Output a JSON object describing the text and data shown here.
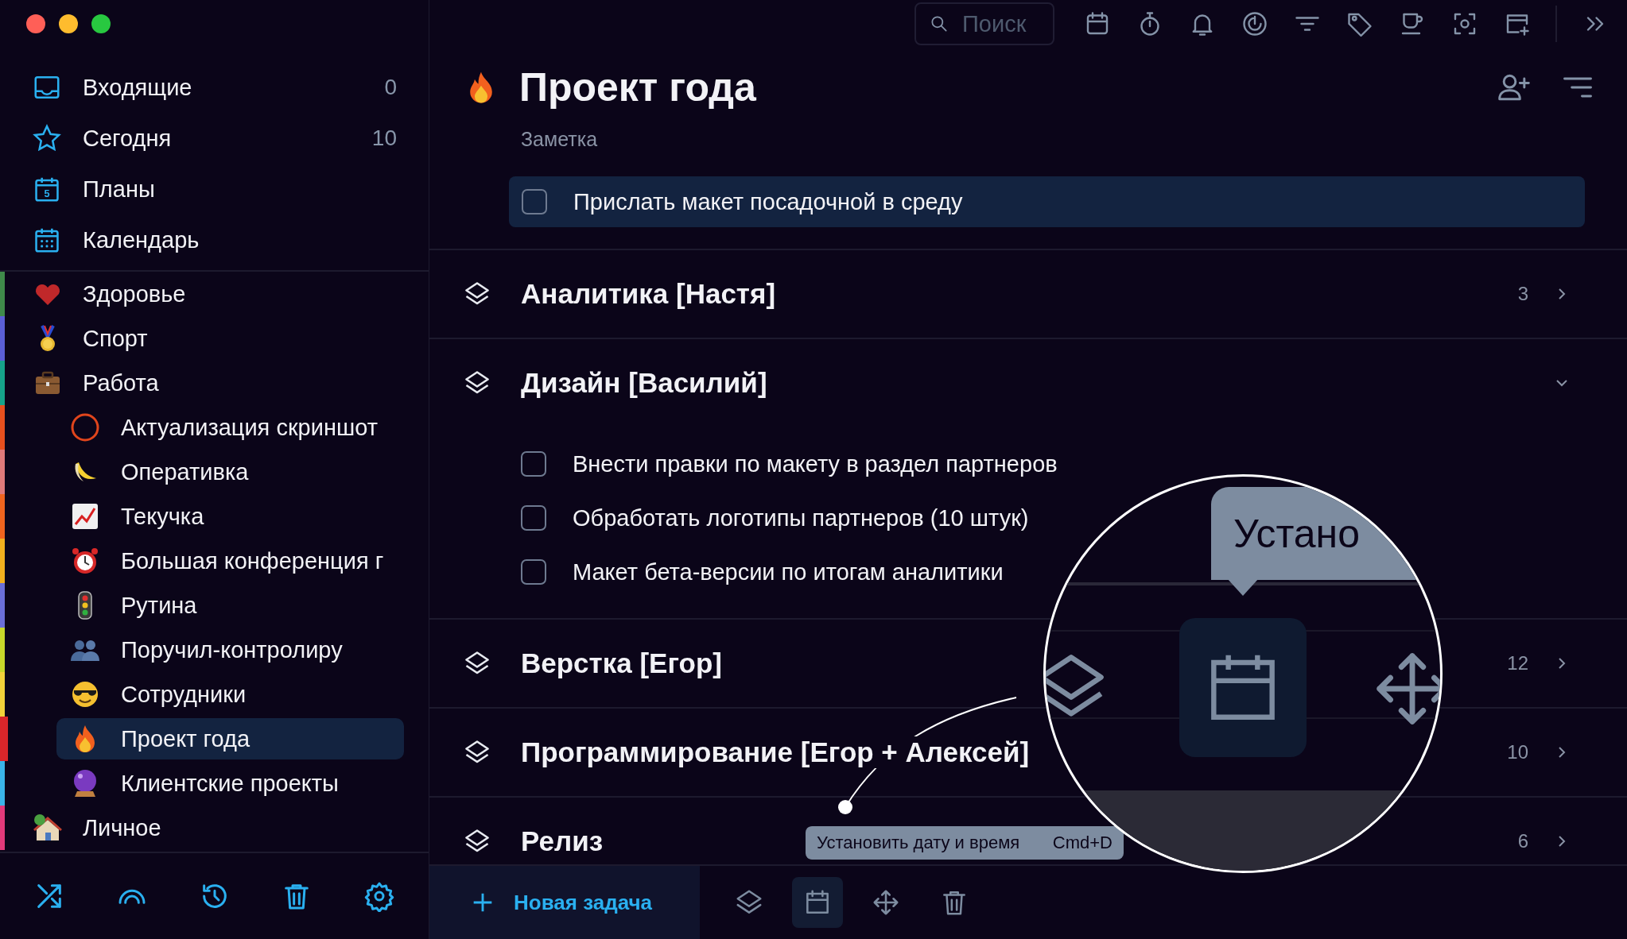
{
  "sidebar": {
    "nav": [
      {
        "label": "Входящие",
        "count": "0"
      },
      {
        "label": "Сегодня",
        "count": "10"
      },
      {
        "label": "Планы",
        "icon_text": "5"
      },
      {
        "label": "Календарь"
      }
    ],
    "projects": [
      {
        "label": "Здоровье",
        "color": "#3f8a4a",
        "selected": false
      },
      {
        "label": "Спорт",
        "color": "#5b5fd6",
        "selected": false
      },
      {
        "label": "Работа",
        "color": "#16a38a",
        "selected": false,
        "children": [
          {
            "label": "Актуализация скриншот",
            "color": "#e8501e",
            "selected": false
          },
          {
            "label": "Оперативка",
            "color": "#e07a7a",
            "selected": false
          },
          {
            "label": "Текучка",
            "color": "#f0641e",
            "selected": false
          },
          {
            "label": "Большая конференция г",
            "color": "#f2b01e",
            "selected": false
          },
          {
            "label": "Рутина",
            "color": "#6b6fd8",
            "selected": false
          },
          {
            "label": "Поручил-контролиру",
            "color": "#c8d82a",
            "selected": false
          },
          {
            "label": "Сотрудники",
            "color": "#f2d23a",
            "selected": false
          },
          {
            "label": "Проект года",
            "color": "#d8262a",
            "selected": true
          },
          {
            "label": "Клиентские проекты",
            "color": "#3ab4e8",
            "selected": false
          }
        ]
      },
      {
        "label": "Личное",
        "color": "#e23a7a",
        "selected": false
      }
    ]
  },
  "main": {
    "search": {
      "placeholder": "Поиск"
    },
    "title": "Проект года",
    "note": "Заметка",
    "pinned_task": {
      "text": "Прислать макет посадочной в среду",
      "checked": false,
      "selected": true
    },
    "sections": [
      {
        "title": "Аналитика [Настя]",
        "count": "3",
        "expanded": false
      },
      {
        "title": "Дизайн [Василий]",
        "expanded": true,
        "tasks": [
          {
            "text": "Внести правки по макету в раздел партнеров",
            "checked": false
          },
          {
            "text": "Обработать логотипы партнеров (10 штук)",
            "checked": false
          },
          {
            "text": "Макет бета-версии по итогам аналитики",
            "checked": false
          }
        ]
      },
      {
        "title": "Верстка [Егор]",
        "count": "12",
        "expanded": false
      },
      {
        "title": "Программирование [Егор + Алексей]",
        "count": "10",
        "expanded": false
      },
      {
        "title": "Релиз",
        "count": "6",
        "expanded": false
      }
    ],
    "bottom_bar": {
      "new_task": "Новая задача",
      "tools": [
        {
          "kind": "layers",
          "selected": false
        },
        {
          "kind": "calendar",
          "selected": true
        },
        {
          "kind": "move",
          "selected": false
        },
        {
          "kind": "trash",
          "selected": false
        }
      ]
    },
    "tooltip": {
      "text": "Установить дату и время",
      "shortcut": "Cmd+D"
    },
    "magnifier": {
      "tooltip_text": "Устано"
    }
  }
}
